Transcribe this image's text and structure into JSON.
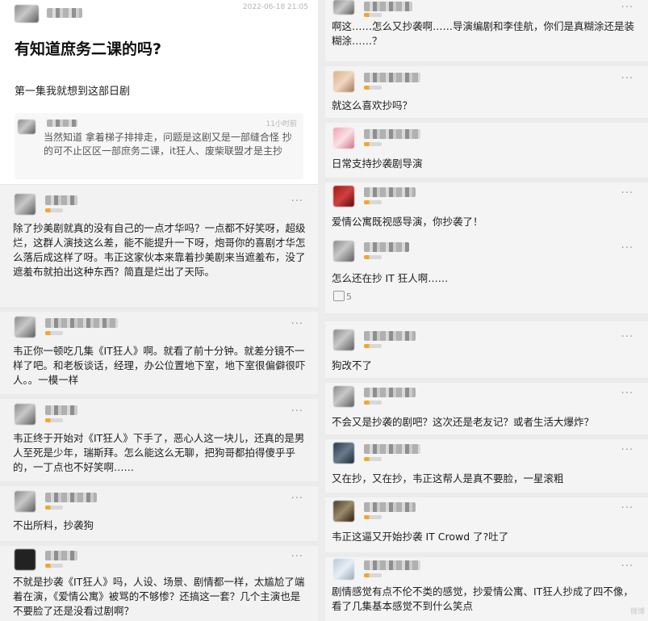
{
  "post": {
    "timestamp": "2022-06-18 21:05",
    "title": "有知道庶务二课的吗?",
    "body": "第一集我就想到这部日剧",
    "reply": {
      "time": "11小时前",
      "text": "当然知道 拿着梯子排排走，问题是这剧又是一部缝合怪 抄的可不止区区一部庶务二课，it狂人、废柴联盟才是主抄"
    }
  },
  "left_comments": [
    {
      "text": "除了抄美剧就真的没有自己的一点才华吗？一点都不好笑呀，超级烂，这群人演技这么差，能不能提升一下呀，炮哥你的喜剧才华怎么落后成这样了呀。韦正这家伙本来靠着抄美剧来当遮羞布，没了遮羞布就拍出这种东西？简直是烂出了天际。"
    },
    {
      "text": "韦正你一顿吃几集《IT狂人》啊。就看了前十分钟。就差分镜不一样了吧。和老板谈话，经理，办公位置地下室，地下室很偏僻很吓人。。一模一样"
    },
    {
      "text": "韦正终于开始对《IT狂人》下手了，恶心人这一块儿，还真的是男人至死是少年，瑞斯拜。怎么能这么无聊，把狗哥都拍得傻乎乎的，一丁点也不好笑啊……"
    },
    {
      "text": "不出所料，抄袭狗"
    },
    {
      "text": "不就是抄袭《IT狂人》吗，人设、场景、剧情都一样，太尴尬了端着在演，《爱情公寓》被骂的不够惨？还搞这一套？几个主演也是不要脸了还是没看过剧啊？"
    }
  ],
  "right_comments": [
    {
      "text": "啊这……怎么又抄袭啊……导演编剧和李佳航，你们是真糊涂还是装糊涂……？"
    },
    {
      "text": "就这么喜欢抄吗？"
    },
    {
      "text": "日常支持抄袭剧导演"
    },
    {
      "text": "爱情公寓既视感导演，你抄袭了！"
    },
    {
      "text": "怎么还在抄 IT 狂人啊……",
      "likes": "5"
    },
    {
      "text": "狗改不了"
    },
    {
      "text": "不会又是抄袭的剧吧？这次还是老友记？或者生活大爆炸？"
    },
    {
      "text": "又在抄，又在抄，韦正这帮人是真不要脸，一星滚粗"
    },
    {
      "text": "韦正这逼又开始抄袭 IT Crowd 了?吐了"
    },
    {
      "text": "剧情感觉有点不伦不类的感觉，抄爱情公寓、IT狂人抄成了四不像，看了几集基本感觉不到什么笑点"
    }
  ],
  "ui": {
    "more_label": "···",
    "watermark": "微博"
  }
}
